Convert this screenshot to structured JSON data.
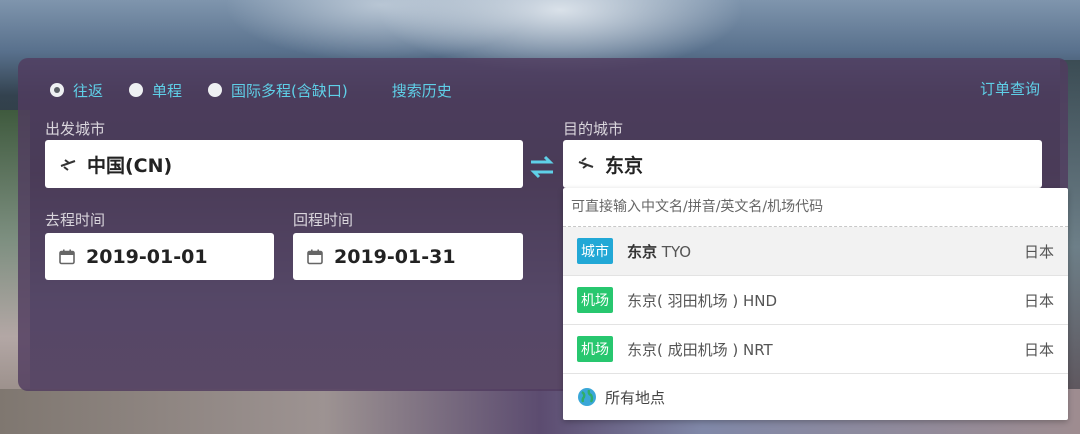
{
  "trip_types": [
    {
      "label": "往返",
      "checked": true
    },
    {
      "label": "单程",
      "checked": false
    },
    {
      "label": "国际多程(含缺口)",
      "checked": false
    }
  ],
  "search_history_label": "搜索历史",
  "order_query_label": "订单查询",
  "departure": {
    "label": "出发城市",
    "value": "中国(CN)"
  },
  "destination": {
    "label": "目的城市",
    "value": "东京"
  },
  "depart_date": {
    "label": "去程时间",
    "value": "2019-01-01"
  },
  "return_date": {
    "label": "回程时间",
    "value": "2019-01-31"
  },
  "dropdown": {
    "hint": "可直接输入中文名/拼音/英文名/机场代码",
    "options": [
      {
        "tag": "城市",
        "name": "东京",
        "code": "TYO",
        "country": "日本"
      },
      {
        "tag": "机场",
        "name": "东京( 羽田机场 ) HND",
        "country": "日本"
      },
      {
        "tag": "机场",
        "name": "东京( 成田机场 ) NRT",
        "country": "日本"
      }
    ],
    "all_places_label": "所有地点"
  },
  "colors": {
    "accent": "#5fd0e8",
    "city_tag": "#22a8d6",
    "airport_tag": "#28c76f",
    "panel": "#503c5f"
  }
}
